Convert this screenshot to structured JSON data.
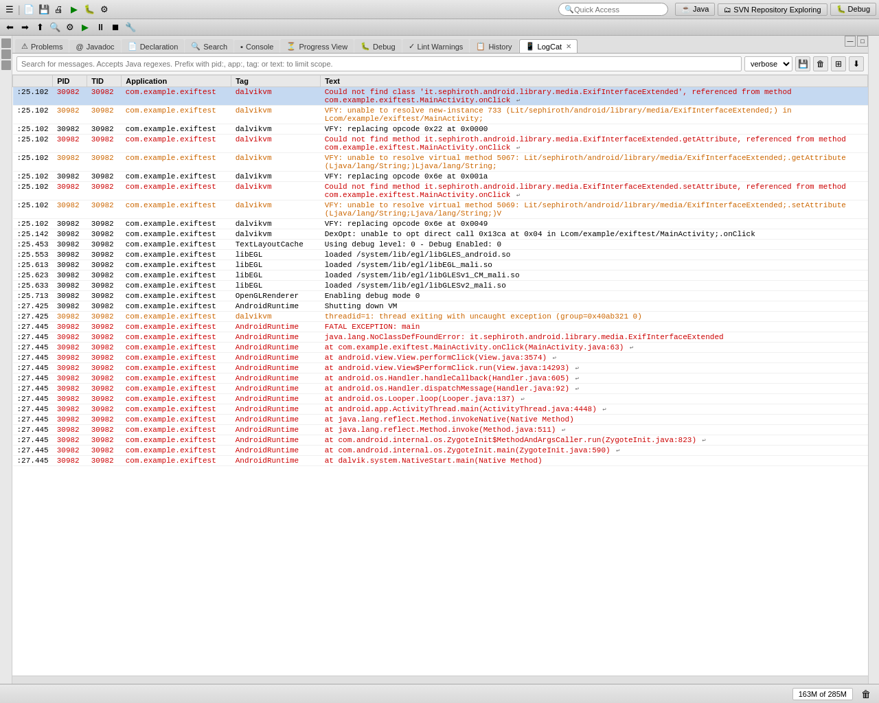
{
  "toolbar": {
    "quick_access_placeholder": "Quick Access",
    "icons": [
      "☰",
      "⬆",
      "⬇",
      "💾",
      "🔍",
      "⚙",
      "▶",
      "⏸",
      "⏹",
      "🔧"
    ]
  },
  "top_right_tabs": [
    {
      "label": "Java",
      "icon": "☕"
    },
    {
      "label": "SVN Repository Exploring",
      "icon": "🗂"
    },
    {
      "label": "Debug",
      "icon": "🐛"
    }
  ],
  "tabs": [
    {
      "label": "Problems",
      "icon": "⚠",
      "active": false
    },
    {
      "label": "Javadoc",
      "icon": "@",
      "active": false
    },
    {
      "label": "Declaration",
      "icon": "📄",
      "active": false
    },
    {
      "label": "Search",
      "icon": "🔍",
      "active": false
    },
    {
      "label": "Console",
      "icon": "▪",
      "active": false
    },
    {
      "label": "Progress View",
      "icon": "⏳",
      "active": false
    },
    {
      "label": "Debug",
      "icon": "🐛",
      "active": false
    },
    {
      "label": "Lint Warnings",
      "icon": "✓",
      "active": false
    },
    {
      "label": "History",
      "icon": "📋",
      "active": false
    },
    {
      "label": "LogCat",
      "icon": "📱",
      "active": true,
      "closeable": true
    }
  ],
  "logcat": {
    "search_placeholder": "Search for messages. Accepts Java regexes. Prefix with pid:, app:, tag: or text: to limit scope.",
    "verbose_label": "verbose",
    "columns": [
      "",
      "PID",
      "TID",
      "Application",
      "Tag",
      "Text"
    ],
    "rows": [
      {
        "time": ":25.102",
        "pid": "30982",
        "tid": "30982",
        "app": "com.example.exiftest",
        "tag": "dalvikvm",
        "text": "Could not find class 'it.sephiroth.android.library.media.ExifInterfaceExtended', referenced from method com.example.exiftest.MainActivity.onClick",
        "color": "red",
        "selected": true
      },
      {
        "time": ":25.102",
        "pid": "30982",
        "tid": "30982",
        "app": "com.example.exiftest",
        "tag": "dalvikvm",
        "text": "VFY: unable to resolve new-instance 733 (Lit/sephiroth/android/library/media/ExifInterfaceExtended;) in Lcom/example/exiftest/MainActivity;",
        "color": "orange"
      },
      {
        "time": ":25.102",
        "pid": "30982",
        "tid": "30982",
        "app": "com.example.exiftest",
        "tag": "dalvikvm",
        "text": "VFY: replacing opcode 0x22 at 0x0000",
        "color": "black"
      },
      {
        "time": ":25.102",
        "pid": "30982",
        "tid": "30982",
        "app": "com.example.exiftest",
        "tag": "dalvikvm",
        "text": "Could not find method it.sephiroth.android.library.media.ExifInterfaceExtended.getAttribute, referenced from method com.example.exiftest.MainActivity.onClick",
        "color": "red"
      },
      {
        "time": ":25.102",
        "pid": "30982",
        "tid": "30982",
        "app": "com.example.exiftest",
        "tag": "dalvikvm",
        "text": "VFY: unable to resolve virtual method 5067: Lit/sephiroth/android/library/media/ExifInterfaceExtended;.getAttribute (Ljava/lang/String;)Ljava/lang/String;",
        "color": "orange"
      },
      {
        "time": ":25.102",
        "pid": "30982",
        "tid": "30982",
        "app": "com.example.exiftest",
        "tag": "dalvikvm",
        "text": "VFY: replacing opcode 0x6e at 0x001a",
        "color": "black"
      },
      {
        "time": ":25.102",
        "pid": "30982",
        "tid": "30982",
        "app": "com.example.exiftest",
        "tag": "dalvikvm",
        "text": "Could not find method it.sephiroth.android.library.media.ExifInterfaceExtended.setAttribute, referenced from method com.example.exiftest.MainActivity.onClick",
        "color": "red"
      },
      {
        "time": ":25.102",
        "pid": "30982",
        "tid": "30982",
        "app": "com.example.exiftest",
        "tag": "dalvikvm",
        "text": "VFY: unable to resolve virtual method 5069: Lit/sephiroth/android/library/media/ExifInterfaceExtended;.setAttribute (Ljava/lang/String;Ljava/lang/String;)V",
        "color": "orange"
      },
      {
        "time": ":25.102",
        "pid": "30982",
        "tid": "30982",
        "app": "com.example.exiftest",
        "tag": "dalvikvm",
        "text": "VFY: replacing opcode 0x6e at 0x0049",
        "color": "black"
      },
      {
        "time": ":25.142",
        "pid": "30982",
        "tid": "30982",
        "app": "com.example.exiftest",
        "tag": "dalvikvm",
        "text": "DexOpt: unable to opt direct call 0x13ca at 0x04 in Lcom/example/exiftest/MainActivity;.onClick",
        "color": "black"
      },
      {
        "time": ":25.453",
        "pid": "30982",
        "tid": "30982",
        "app": "com.example.exiftest",
        "tag": "TextLayoutCache",
        "text": "Using debug level: 0 - Debug Enabled: 0",
        "color": "black"
      },
      {
        "time": ":25.553",
        "pid": "30982",
        "tid": "30982",
        "app": "com.example.exiftest",
        "tag": "libEGL",
        "text": "loaded /system/lib/egl/libGLES_android.so",
        "color": "black"
      },
      {
        "time": ":25.613",
        "pid": "30982",
        "tid": "30982",
        "app": "com.example.exiftest",
        "tag": "libEGL",
        "text": "loaded /system/lib/egl/libEGL_mali.so",
        "color": "black"
      },
      {
        "time": ":25.623",
        "pid": "30982",
        "tid": "30982",
        "app": "com.example.exiftest",
        "tag": "libEGL",
        "text": "loaded /system/lib/egl/libGLESv1_CM_mali.so",
        "color": "black"
      },
      {
        "time": ":25.633",
        "pid": "30982",
        "tid": "30982",
        "app": "com.example.exiftest",
        "tag": "libEGL",
        "text": "loaded /system/lib/egl/libGLESv2_mali.so",
        "color": "black"
      },
      {
        "time": ":25.713",
        "pid": "30982",
        "tid": "30982",
        "app": "com.example.exiftest",
        "tag": "OpenGLRenderer",
        "text": "Enabling debug mode 0",
        "color": "black"
      },
      {
        "time": ":27.425",
        "pid": "30982",
        "tid": "30982",
        "app": "com.example.exiftest",
        "tag": "AndroidRuntime",
        "text": "Shutting down VM",
        "color": "black"
      },
      {
        "time": ":27.425",
        "pid": "30982",
        "tid": "30982",
        "app": "com.example.exiftest",
        "tag": "dalvikvm",
        "text": "threadid=1: thread exiting with uncaught exception (group=0x40ab321 0)",
        "color": "orange"
      },
      {
        "time": ":27.445",
        "pid": "30982",
        "tid": "30982",
        "app": "com.example.exiftest",
        "tag": "AndroidRuntime",
        "text": "FATAL EXCEPTION: main",
        "color": "red"
      },
      {
        "time": ":27.445",
        "pid": "30982",
        "tid": "30982",
        "app": "com.example.exiftest",
        "tag": "AndroidRuntime",
        "text": "java.lang.NoClassDefFoundError: it.sephiroth.android.library.media.ExifInterfaceExtended",
        "color": "red"
      },
      {
        "time": ":27.445",
        "pid": "30982",
        "tid": "30982",
        "app": "com.example.exiftest",
        "tag": "AndroidRuntime",
        "text": "    at com.example.exiftest.MainActivity.onClick(MainActivity.java:63)",
        "color": "red"
      },
      {
        "time": ":27.445",
        "pid": "30982",
        "tid": "30982",
        "app": "com.example.exiftest",
        "tag": "AndroidRuntime",
        "text": "    at android.view.View.performClick(View.java:3574)",
        "color": "red"
      },
      {
        "time": ":27.445",
        "pid": "30982",
        "tid": "30982",
        "app": "com.example.exiftest",
        "tag": "AndroidRuntime",
        "text": "    at android.view.View$PerformClick.run(View.java:14293)",
        "color": "red"
      },
      {
        "time": ":27.445",
        "pid": "30982",
        "tid": "30982",
        "app": "com.example.exiftest",
        "tag": "AndroidRuntime",
        "text": "    at android.os.Handler.handleCallback(Handler.java:605)",
        "color": "red"
      },
      {
        "time": ":27.445",
        "pid": "30982",
        "tid": "30982",
        "app": "com.example.exiftest",
        "tag": "AndroidRuntime",
        "text": "    at android.os.Handler.dispatchMessage(Handler.java:92)",
        "color": "red"
      },
      {
        "time": ":27.445",
        "pid": "30982",
        "tid": "30982",
        "app": "com.example.exiftest",
        "tag": "AndroidRuntime",
        "text": "    at android.os.Looper.loop(Looper.java:137)",
        "color": "red"
      },
      {
        "time": ":27.445",
        "pid": "30982",
        "tid": "30982",
        "app": "com.example.exiftest",
        "tag": "AndroidRuntime",
        "text": "    at android.app.ActivityThread.main(ActivityThread.java:4448)",
        "color": "red"
      },
      {
        "time": ":27.445",
        "pid": "30982",
        "tid": "30982",
        "app": "com.example.exiftest",
        "tag": "AndroidRuntime",
        "text": "    at java.lang.reflect.Method.invokeNative(Native Method)",
        "color": "red"
      },
      {
        "time": ":27.445",
        "pid": "30982",
        "tid": "30982",
        "app": "com.example.exiftest",
        "tag": "AndroidRuntime",
        "text": "    at java.lang.reflect.Method.invoke(Method.java:511)",
        "color": "red"
      },
      {
        "time": ":27.445",
        "pid": "30982",
        "tid": "30982",
        "app": "com.example.exiftest",
        "tag": "AndroidRuntime",
        "text": "    at com.android.internal.os.ZygoteInit$MethodAndArgsCaller.run(ZygoteInit.java:823)",
        "color": "red"
      },
      {
        "time": ":27.445",
        "pid": "30982",
        "tid": "30982",
        "app": "com.example.exiftest",
        "tag": "AndroidRuntime",
        "text": "    at com.android.internal.os.ZygoteInit.main(ZygoteInit.java:590)",
        "color": "red"
      },
      {
        "time": ":27.445",
        "pid": "30982",
        "tid": "30982",
        "app": "com.example.exiftest",
        "tag": "AndroidRuntime",
        "text": "    at dalvik.system.NativeStart.main(Native Method)",
        "color": "red"
      }
    ]
  },
  "status_bar": {
    "memory": "163M of 285M",
    "gc_icon": "🗑"
  }
}
